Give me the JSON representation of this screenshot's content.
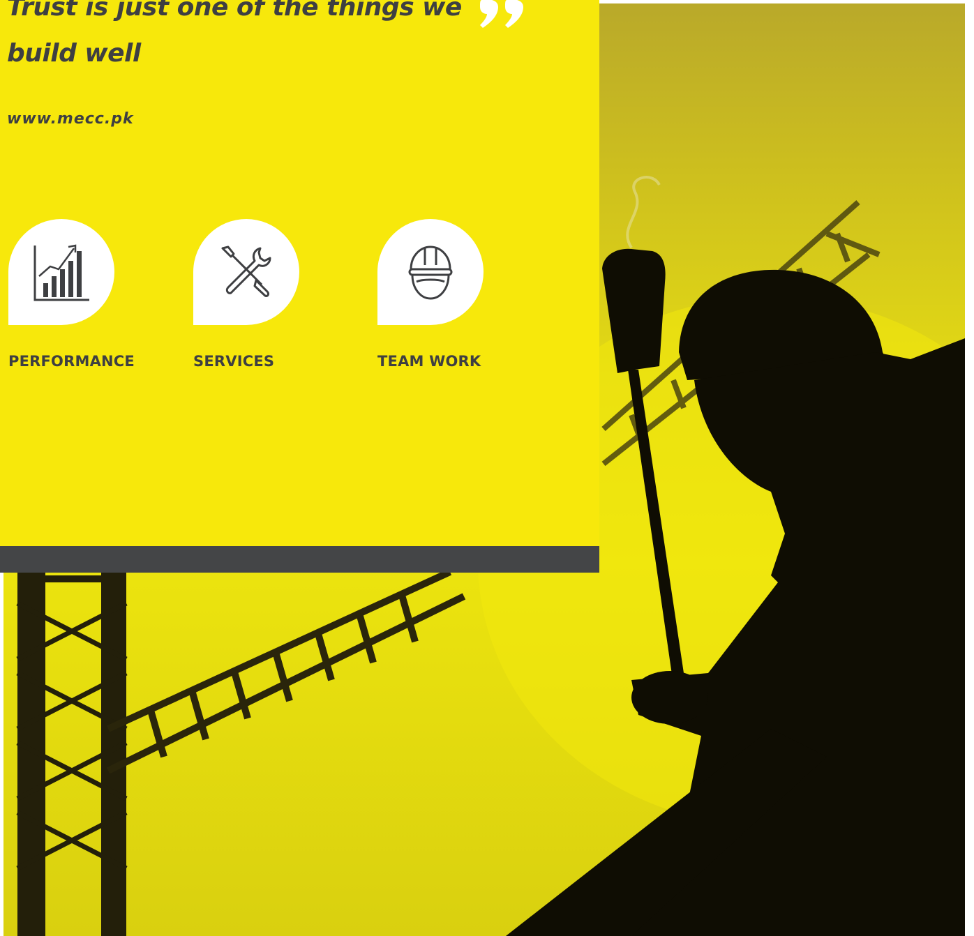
{
  "hero": {
    "quote": "Trust is just one of the things we build well",
    "website": "www.mecc.pk"
  },
  "features": [
    {
      "label": "PERFORMANCE",
      "icon": "growth-chart-icon"
    },
    {
      "label": "SERVICES",
      "icon": "tools-icon"
    },
    {
      "label": "TEAM WORK",
      "icon": "hard-hat-icon"
    }
  ],
  "colors": {
    "panel": "#f7e80b",
    "text": "#3e3f42",
    "footer_bar": "#444547",
    "bubble": "#ffffff"
  }
}
